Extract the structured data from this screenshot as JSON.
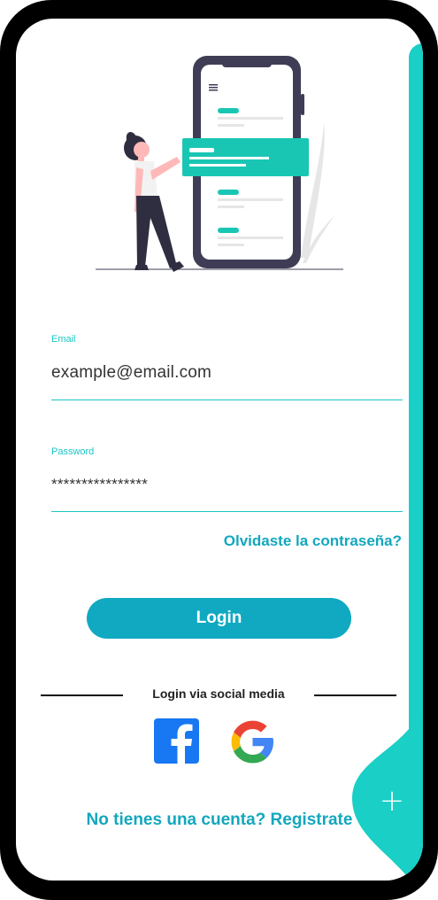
{
  "form": {
    "email_label": "Email",
    "email_value": "example@email.com",
    "password_label": "Password",
    "password_value": "****************",
    "forgot_link": "Olvidaste la contraseña?",
    "login_button": "Login"
  },
  "social": {
    "divider_text": "Login via social media",
    "facebook_icon": "facebook-icon",
    "google_icon": "google-icon"
  },
  "footer": {
    "register_link": "No tienes una cuenta? Registrate"
  },
  "fab": {
    "icon": "plus-icon"
  },
  "colors": {
    "accent": "#19c6c4",
    "link": "#13a7bd",
    "button": "#10a9c1",
    "strip": "#19cfc6"
  }
}
